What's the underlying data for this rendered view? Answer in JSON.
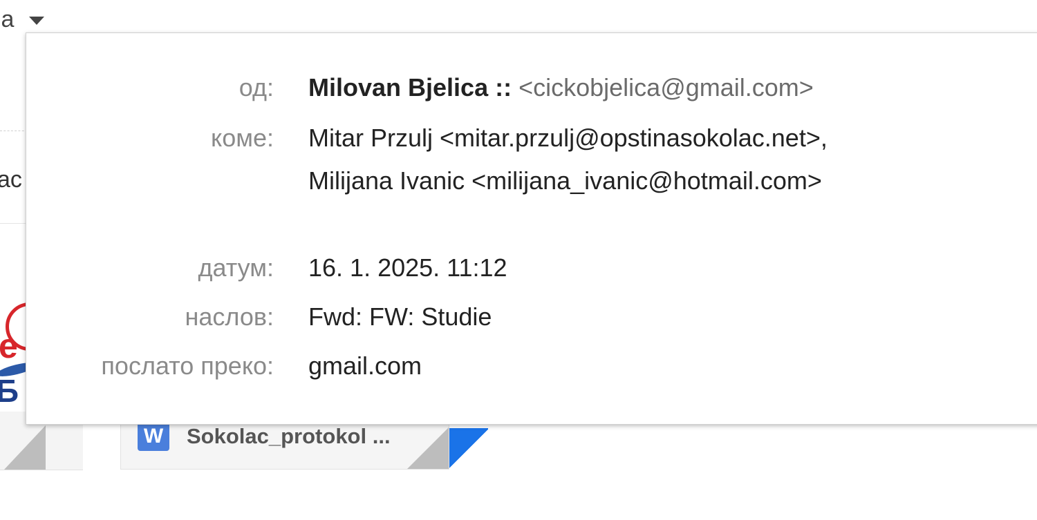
{
  "background": {
    "top_fragment": "іа",
    "side_fragment": "ас",
    "attachment": {
      "icon": "word-icon",
      "icon_letter": "W",
      "filename": "Sokolac_protokol ..."
    }
  },
  "details": {
    "from": {
      "label": "од:",
      "name": "Milovan Bjelica ::",
      "email": "<cickobjelica@gmail.com>"
    },
    "to": {
      "label": "коме:",
      "recipients": [
        "Mitar Przulj <mitar.przulj@opstinasokolac.net>,",
        "Milijana Ivanic <milijana_ivanic@hotmail.com>"
      ]
    },
    "date": {
      "label": "датум:",
      "value": "16. 1. 2025. 11:12"
    },
    "subject": {
      "label": "наслов:",
      "value": "Fwd: FW: Studie"
    },
    "mailed_by": {
      "label": "послато преко:",
      "value": "gmail.com"
    }
  },
  "colors": {
    "label": "#8a8a8a",
    "value": "#222222",
    "email_muted": "#6b6b6b",
    "accent_blue": "#1a73e8"
  }
}
